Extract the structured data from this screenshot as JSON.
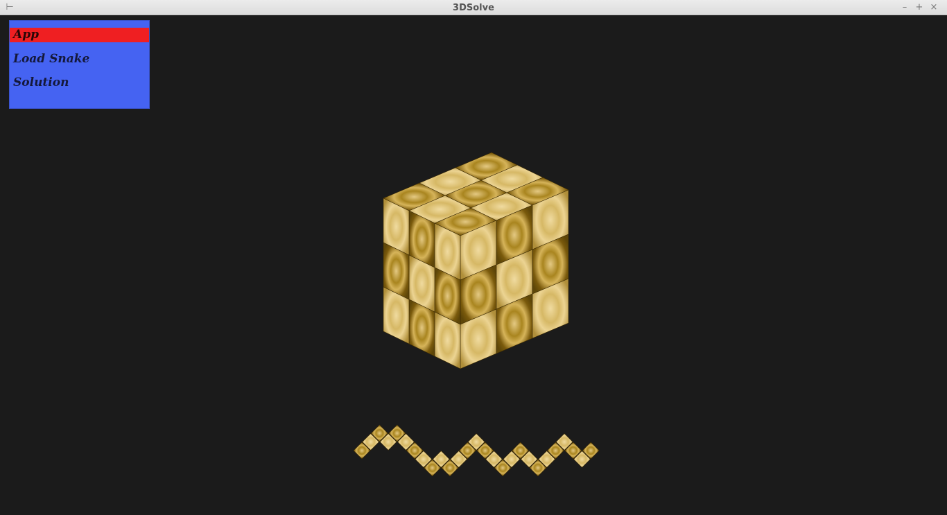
{
  "window": {
    "title": "3DSolve",
    "pin_glyph": "⊢",
    "minimize_glyph": "–",
    "maximize_glyph": "+",
    "close_glyph": "×"
  },
  "menu": {
    "items": [
      {
        "label": "App",
        "selected": true
      },
      {
        "label": "Load Snake",
        "selected": false
      },
      {
        "label": "Solution",
        "selected": false
      }
    ]
  },
  "colors": {
    "background": "#1b1b1b",
    "menu_bg": "#4563f2",
    "menu_selected": "#ef1f22",
    "wood_dark": "#8a6a12",
    "wood_light": "#d8b865"
  },
  "scene": {
    "cube_grid": "3x3x3",
    "snake_segments": 27
  }
}
